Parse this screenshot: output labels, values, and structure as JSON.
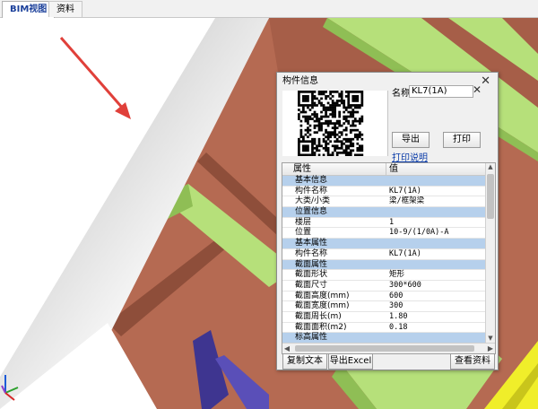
{
  "tabs": [
    {
      "label": "BIM视图",
      "active": true
    },
    {
      "label": "资料",
      "active": false
    }
  ],
  "dialog": {
    "title": "构件信息",
    "close_glyph": "✕",
    "name_label": "名称:",
    "name_value": "KL7(1A)",
    "clear_glyph": "✕",
    "export_button": "导出",
    "print_button": "打印",
    "print_help_link": "打印说明",
    "grid_headers": [
      "属性",
      "值"
    ],
    "rows": [
      {
        "key": "基本信息",
        "value": "",
        "group": true
      },
      {
        "key": "构件名称",
        "value": "KL7(1A)",
        "group": false
      },
      {
        "key": "大类/小类",
        "value": "梁/框架梁",
        "group": false
      },
      {
        "key": "位置信息",
        "value": "",
        "group": true
      },
      {
        "key": "楼层",
        "value": "1",
        "group": false
      },
      {
        "key": "位置",
        "value": "10-9/(1/0A)-A",
        "group": false
      },
      {
        "key": "基本属性",
        "value": "",
        "group": true
      },
      {
        "key": "构件名称",
        "value": "KL7(1A)",
        "group": false
      },
      {
        "key": "截面属性",
        "value": "",
        "group": true
      },
      {
        "key": "截面形状",
        "value": "矩形",
        "group": false
      },
      {
        "key": "截面尺寸",
        "value": "300*600",
        "group": false
      },
      {
        "key": "截面高度(mm)",
        "value": "600",
        "group": false
      },
      {
        "key": "截面宽度(mm)",
        "value": "300",
        "group": false
      },
      {
        "key": "截面周长(m)",
        "value": "1.80",
        "group": false
      },
      {
        "key": "截面面积(m2)",
        "value": "0.18",
        "group": false
      },
      {
        "key": "标高属性",
        "value": "",
        "group": true
      }
    ],
    "copy_text_button": "复制文本",
    "export_excel_button": "导出Excel",
    "view_docs_button": "查看资料"
  },
  "colors": {
    "beam_brown": "#b56a52",
    "beam_green": "#b6e07a",
    "accent_red_arrow": "#e0403a",
    "selected_tab_text": "#1a3f9a",
    "group_row": "#b6d0ec"
  },
  "icons": {
    "axis": "xyz-axis-icon",
    "close": "close-icon",
    "qr": "qr-code-icon"
  }
}
